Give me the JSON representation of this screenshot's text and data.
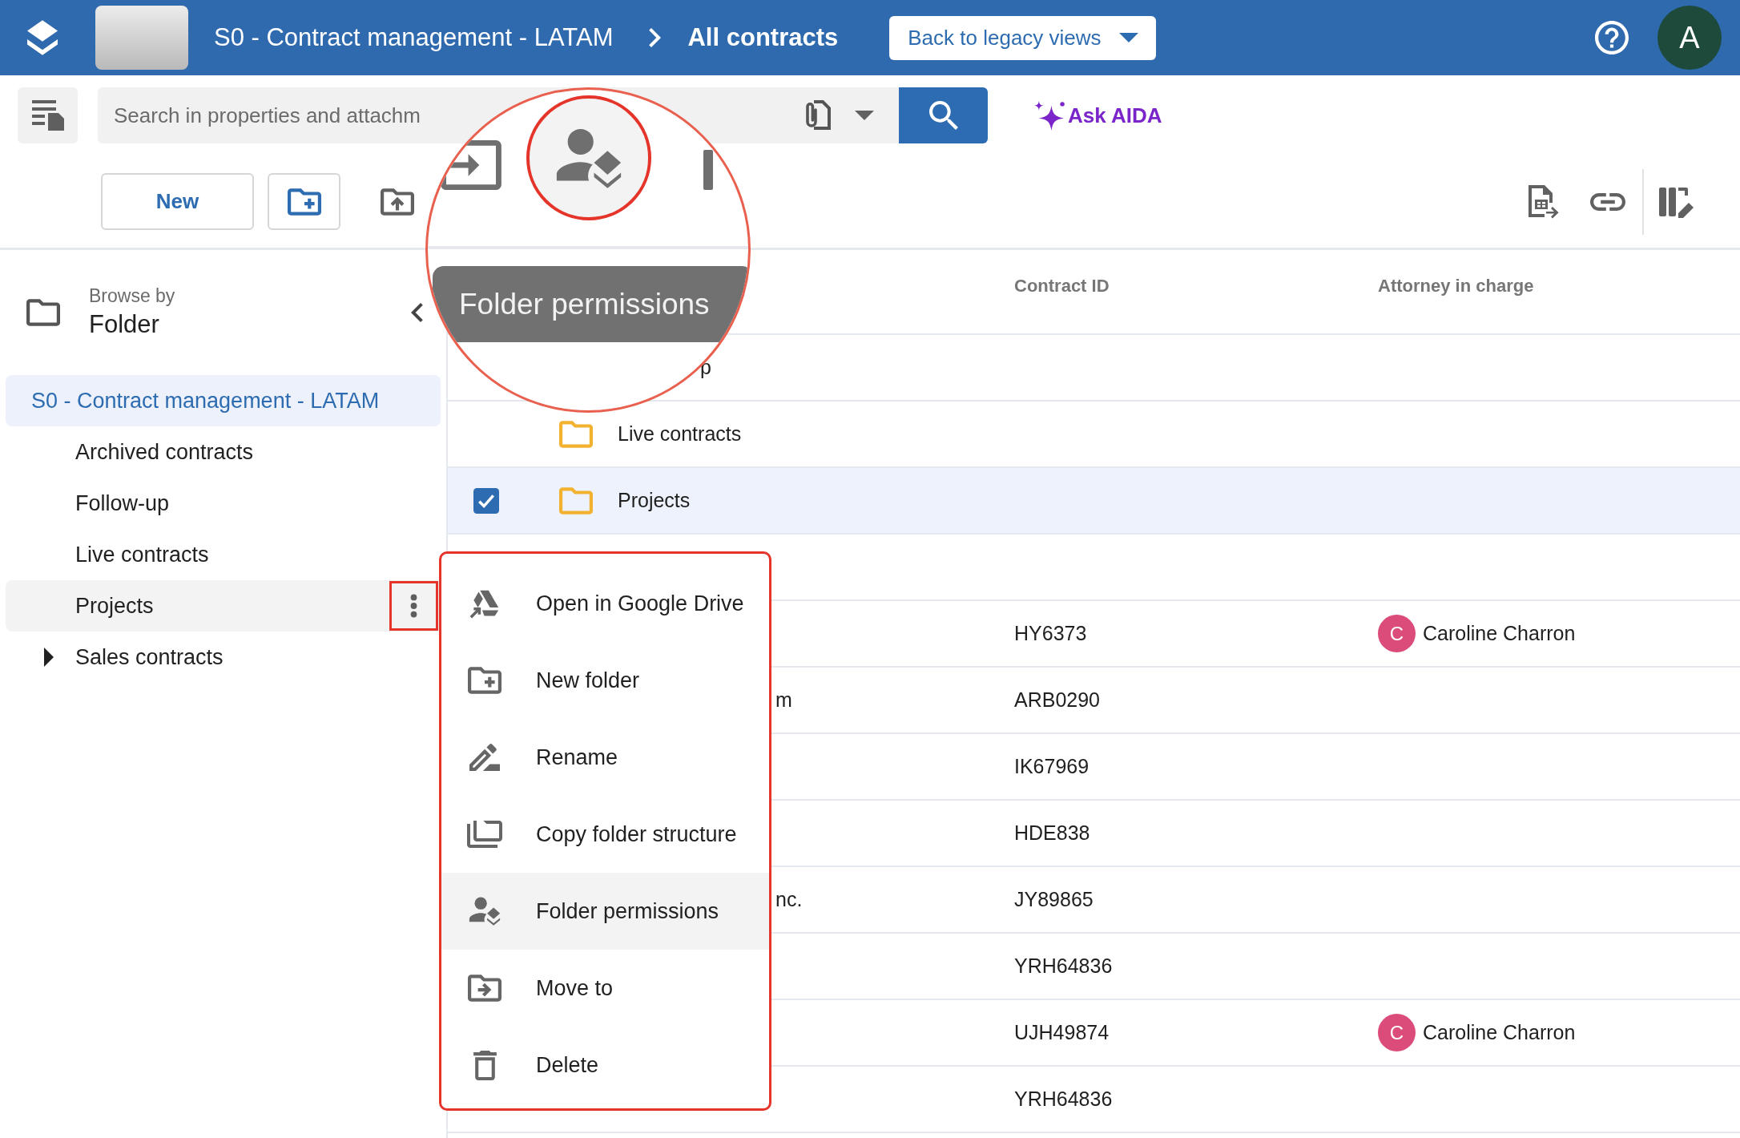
{
  "header": {
    "breadcrumb": [
      {
        "label": "S0 - Contract management - LATAM",
        "current": false
      },
      {
        "label": "All contracts",
        "current": true
      }
    ],
    "legacy_button": {
      "label": "Back to legacy views"
    },
    "user": {
      "initial": "A"
    }
  },
  "toolbar": {
    "search": {
      "placeholder": "Search in properties and attachm"
    },
    "ask_ai": {
      "label": "Ask AIDA"
    },
    "new_button": {
      "label": "New"
    }
  },
  "sidebar": {
    "browse_by": {
      "caption": "Browse by",
      "value": "Folder"
    },
    "tree": [
      {
        "label": "S0 - Contract management - LATAM",
        "selected": true,
        "hovered": false,
        "children": [
          {
            "label": "Archived contracts",
            "selected": false,
            "hovered": false
          },
          {
            "label": "Follow-up",
            "selected": false,
            "hovered": false
          },
          {
            "label": "Live contracts",
            "selected": false,
            "hovered": false
          },
          {
            "label": "Projects",
            "selected": false,
            "hovered": true
          },
          {
            "label": "Sales contracts",
            "selected": false,
            "hovered": false,
            "expanded": false
          }
        ]
      }
    ]
  },
  "table": {
    "columns": [
      {
        "label": "Contract ID"
      },
      {
        "label": "Attorney in charge"
      }
    ],
    "rows": [
      {
        "kind": "behind_lens",
        "title_tail": "p",
        "selected": false
      },
      {
        "kind": "folder",
        "title": "Live contracts",
        "selected": false
      },
      {
        "kind": "folder",
        "title": "Projects",
        "selected": true
      },
      {
        "kind": "behind_menu",
        "selected": false
      },
      {
        "kind": "behind_menu",
        "contract_id": "HY6373",
        "attorney": {
          "initial": "C",
          "name": "Caroline Charron",
          "color": "#dc4c7a"
        },
        "selected": false
      },
      {
        "kind": "behind_menu",
        "title_tail": "m",
        "contract_id": "ARB0290",
        "selected": false
      },
      {
        "kind": "behind_menu",
        "contract_id": "IK67969",
        "selected": false
      },
      {
        "kind": "behind_menu",
        "contract_id": "HDE838",
        "selected": false
      },
      {
        "kind": "behind_menu",
        "title_tail": "nc.",
        "contract_id": "JY89865",
        "selected": false
      },
      {
        "kind": "behind_menu",
        "contract_id": "YRH64836",
        "selected": false
      },
      {
        "kind": "behind_menu",
        "contract_id": "UJH49874",
        "attorney": {
          "initial": "C",
          "name": "Caroline Charron",
          "color": "#dc4c7a"
        },
        "selected": false
      },
      {
        "kind": "behind_menu",
        "contract_id": "YRH64836",
        "selected": false
      }
    ]
  },
  "context_menu": {
    "items": [
      {
        "label": "Open in Google Drive",
        "highlighted": false
      },
      {
        "label": "New folder",
        "highlighted": false
      },
      {
        "label": "Rename",
        "highlighted": false
      },
      {
        "label": "Copy folder structure",
        "highlighted": false
      },
      {
        "label": "Folder permissions",
        "highlighted": true
      },
      {
        "label": "Move to",
        "highlighted": false
      },
      {
        "label": "Delete",
        "highlighted": false
      }
    ]
  },
  "magnifier": {
    "tooltip": "Folder permissions"
  }
}
